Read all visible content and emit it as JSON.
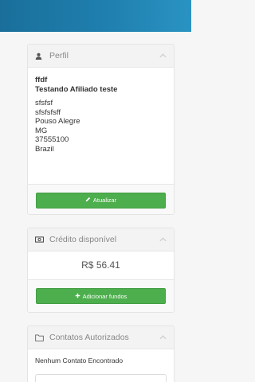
{
  "perfil": {
    "title": "Perfil",
    "icon": "user-icon",
    "company": "ffdf",
    "name": "Testando Afiliado teste",
    "address_lines": [
      "sfsfsf",
      "sfsfsfsff",
      "Pouso Alegre",
      "MG",
      "37555100",
      "Brazil"
    ],
    "button_label": "Atualizar",
    "button_icon": "pencil-icon"
  },
  "credito": {
    "title": "Crédito disponível",
    "icon": "money-icon",
    "value": "R$ 56.41",
    "button_label": "Adicionar fundos",
    "button_icon": "plus-icon"
  },
  "contatos": {
    "title": "Contatos Autorizados",
    "icon": "folder-icon",
    "empty_text": "Nenhum Contato Encontrado"
  },
  "colors": {
    "banner": "#1f7fae",
    "button_green": "#4cae4c",
    "panel_header": "#f3f3f3"
  }
}
